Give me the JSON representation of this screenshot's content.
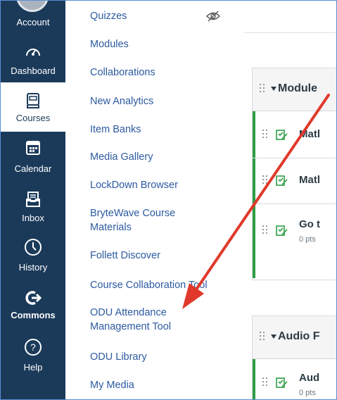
{
  "global_nav": {
    "items": [
      {
        "label": "Account",
        "icon": "account-avatar-icon"
      },
      {
        "label": "Dashboard",
        "icon": "dashboard-icon"
      },
      {
        "label": "Courses",
        "icon": "courses-icon",
        "active": true
      },
      {
        "label": "Calendar",
        "icon": "calendar-icon"
      },
      {
        "label": "Inbox",
        "icon": "inbox-icon"
      },
      {
        "label": "History",
        "icon": "history-icon"
      },
      {
        "label": "Commons",
        "icon": "commons-icon"
      },
      {
        "label": "Help",
        "icon": "help-icon"
      }
    ]
  },
  "course_nav": {
    "links": [
      {
        "label": "Quizzes",
        "hidden_icon": "eye-slash-icon"
      },
      {
        "label": "Modules"
      },
      {
        "label": "Collaborations"
      },
      {
        "label": "New Analytics"
      },
      {
        "label": "Item Banks"
      },
      {
        "label": "Media Gallery"
      },
      {
        "label": "LockDown Browser"
      },
      {
        "label_line1": "BryteWave Course",
        "label_line2": "Materials"
      },
      {
        "label": "Follett Discover"
      },
      {
        "label": "Course Collaboration Tool"
      },
      {
        "label_line1": "ODU Attendance",
        "label_line2": "Management Tool"
      },
      {
        "label": "ODU Library"
      },
      {
        "label": "My Media"
      }
    ]
  },
  "modules": [
    {
      "title": "Module",
      "items": [
        {
          "title": "Matl",
          "sub": ""
        },
        {
          "title": "Matl",
          "sub": ""
        },
        {
          "title": "Go t",
          "sub": "0 pts"
        }
      ]
    },
    {
      "title": "Audio F",
      "items": [
        {
          "title": "Aud",
          "sub": "0 pts"
        }
      ]
    }
  ],
  "colors": {
    "nav_bg": "#1b3a5a",
    "link": "#2c5aa0",
    "published_green": "#2f9e44",
    "annotation_arrow": "#e0392b"
  }
}
